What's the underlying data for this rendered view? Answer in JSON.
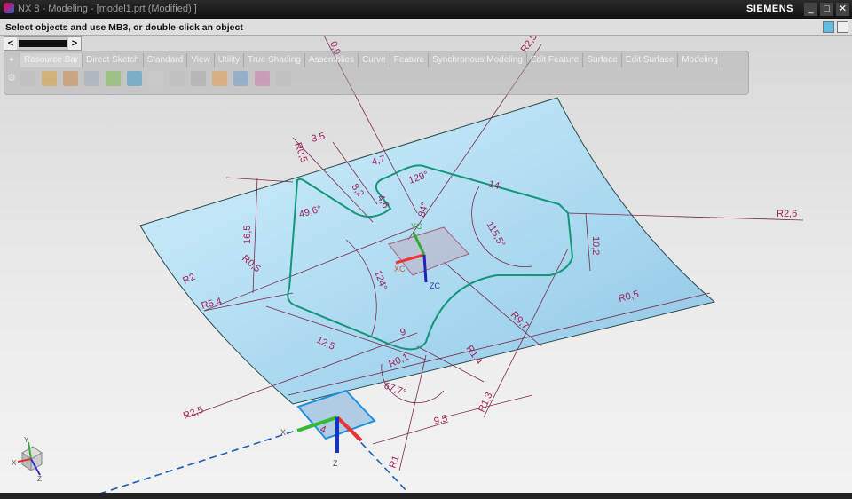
{
  "window": {
    "title": "NX 8 - Modeling - [model1.prt (Modified) ]",
    "brand": "SIEMENS",
    "minimize": "_",
    "maximize": "□",
    "close": "✕"
  },
  "status": {
    "message": "Select objects and use MB3, or double-click an object"
  },
  "scroller": {
    "left": "<",
    "right": ">"
  },
  "toolbar": {
    "tabs": [
      "Resource Bar",
      "Direct Sketch",
      "Standard",
      "View",
      "Utility",
      "True Shading",
      "Assemblies",
      "Curve",
      "Feature",
      "Synchronous Modeling",
      "Edit Feature",
      "Surface",
      "Edit Surface",
      "Modeling"
    ],
    "icons": [
      "part-navigator-icon",
      "constraints-icon",
      "assembly-icon",
      "sketch-icon",
      "palette-icon",
      "web-icon",
      "document-icon",
      "history-icon",
      "list-icon",
      "roles-icon",
      "tools-icon",
      "users-icon",
      "info-icon"
    ]
  },
  "colors": {
    "surface": "#a8d8f0",
    "sketch": "#14967a",
    "dimension": "#a0205a",
    "dimension_line": "#7a2a4a",
    "datum": "#1d5fb5"
  },
  "dimensions": [
    "0,9",
    "R2,5",
    "R0,5",
    "3,5",
    "4,7",
    "8,2",
    "4,6",
    "129°",
    "14",
    "49,6°",
    "84°",
    "115,5°",
    "R2,6",
    "16,5",
    "10,2",
    "R0,5",
    "124°",
    "R2",
    "R5,4",
    "R0,5",
    "R9,7",
    "12,5",
    "R1,4",
    "9",
    "R0,1",
    "67,7°",
    "R1,3",
    "R2,5",
    "9,5",
    "R1",
    "4"
  ],
  "axes": {
    "yc": "YC",
    "xc": "XC",
    "zc": "ZC",
    "datum_x": "X",
    "datum_z": "Z",
    "triad_x": "X",
    "triad_y": "Y",
    "triad_z": "Z"
  }
}
